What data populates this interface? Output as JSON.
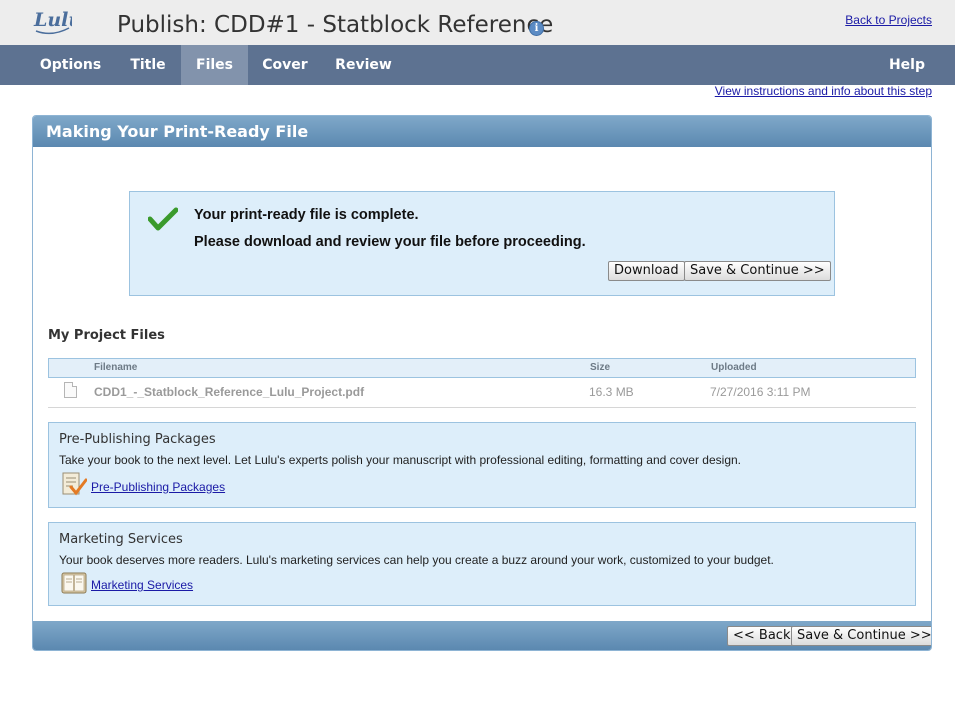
{
  "header": {
    "title": "Publish: CDD#1 - Statblock Reference",
    "logo_text": "Lulu",
    "info_icon": "info-icon",
    "back_link": "Back to Projects"
  },
  "nav": {
    "tabs": [
      {
        "label": "Options",
        "active": false
      },
      {
        "label": "Title",
        "active": false
      },
      {
        "label": "Files",
        "active": true
      },
      {
        "label": "Cover",
        "active": false
      },
      {
        "label": "Review",
        "active": false
      }
    ],
    "help": "Help"
  },
  "instructions_link": "View instructions and info about this step",
  "panel": {
    "title": "Making Your Print-Ready File",
    "status": {
      "icon": "checkmark-icon",
      "line1": "Your print-ready file is complete.",
      "line2": "Please download and review your file before proceeding.",
      "download_label": "Download",
      "save_continue_label": "Save & Continue >>"
    },
    "files": {
      "title": "My Project Files",
      "columns": {
        "filename": "Filename",
        "size": "Size",
        "uploaded": "Uploaded"
      },
      "rows": [
        {
          "filename": "CDD1_-_Statblock_Reference_Lulu_Project.pdf",
          "size": "16.3 MB",
          "uploaded": "7/27/2016 3:11 PM",
          "icon": "document-icon"
        }
      ]
    },
    "services": [
      {
        "title": "Pre-Publishing Packages",
        "desc": "Take your book to the next level. Let Lulu's experts polish your manuscript with professional editing, formatting and cover design.",
        "link": "Pre-Publishing Packages",
        "icon": "document-check-icon"
      },
      {
        "title": "Marketing Services",
        "desc": "Your book deserves more readers. Lulu's marketing services can help you create a buzz around your work, customized to your budget.",
        "link": "Marketing Services",
        "icon": "open-book-icon"
      }
    ],
    "footer": {
      "back_label": "<< Back",
      "save_continue_label": "Save & Continue >>"
    }
  },
  "colors": {
    "nav_bg": "#5d7291",
    "nav_active": "#8293ac",
    "panel_header": "#6e98bd",
    "info_box": "#ddeefa",
    "link": "#1a1aa6"
  }
}
